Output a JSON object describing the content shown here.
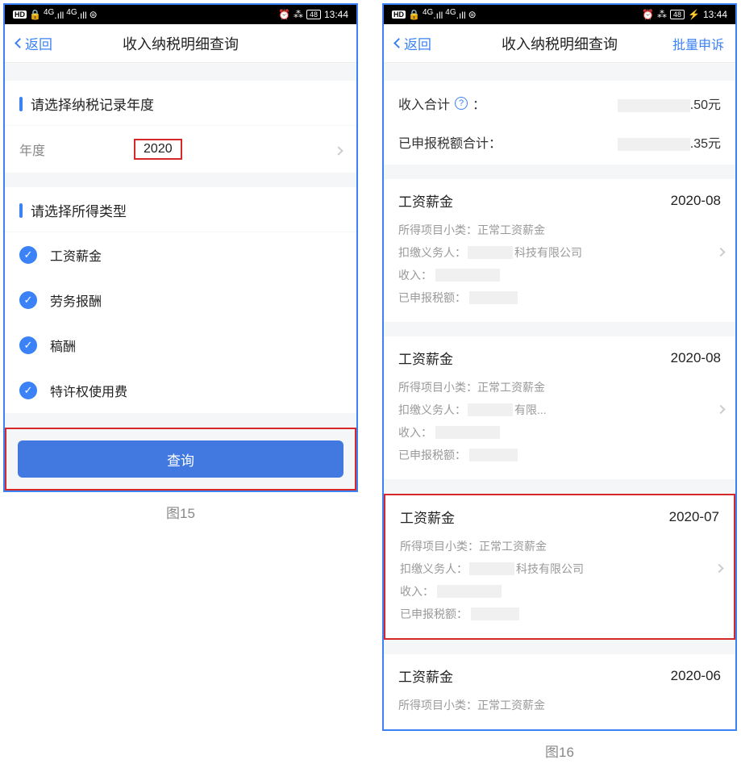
{
  "status": {
    "hd": "HD",
    "signal": "4G",
    "battery": "48",
    "time_left": "13:44",
    "time_right": "13:44"
  },
  "left": {
    "nav": {
      "back": "返回",
      "title": "收入纳税明细查询"
    },
    "section_year": "请选择纳税记录年度",
    "year_label": "年度",
    "year_value": "2020",
    "section_type": "请选择所得类型",
    "types": [
      "工资薪金",
      "劳务报酬",
      "稿酬",
      "特许权使用费"
    ],
    "query_btn": "查询",
    "caption": "图15"
  },
  "right": {
    "nav": {
      "back": "返回",
      "title": "收入纳税明细查询",
      "action": "批量申诉"
    },
    "summary": {
      "income_label": "收入合计",
      "income_suffix": ".50元",
      "tax_label": "已申报税额合计：",
      "tax_suffix": ".35元",
      "colon": "："
    },
    "records": [
      {
        "title": "工资薪金",
        "date": "2020-08",
        "subtype": "正常工资薪金",
        "agent_suffix": "科技有限公司",
        "highlighted": false
      },
      {
        "title": "工资薪金",
        "date": "2020-08",
        "subtype": "正常工资薪金",
        "agent_suffix": "有限...",
        "highlighted": false
      },
      {
        "title": "工资薪金",
        "date": "2020-07",
        "subtype": "正常工资薪金",
        "agent_suffix": "科技有限公司",
        "highlighted": true
      },
      {
        "title": "工资薪金",
        "date": "2020-06",
        "subtype": "正常工资薪金",
        "agent_suffix": "",
        "highlighted": false,
        "truncated": true
      }
    ],
    "labels": {
      "subtype": "所得项目小类：",
      "agent": "扣缴义务人：",
      "income": "收入：",
      "tax": "已申报税额："
    },
    "caption": "图16"
  }
}
